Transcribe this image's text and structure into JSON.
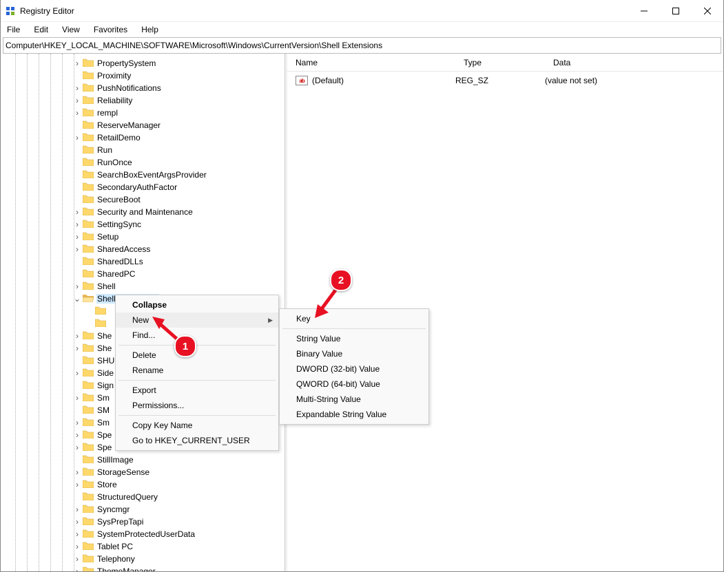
{
  "title": "Registry Editor",
  "menu": {
    "file": "File",
    "edit": "Edit",
    "view": "View",
    "fav": "Favorites",
    "help": "Help"
  },
  "address": "Computer\\HKEY_LOCAL_MACHINE\\SOFTWARE\\Microsoft\\Windows\\CurrentVersion\\Shell Extensions",
  "tree_indent_base": 104,
  "tree": [
    {
      "lvl": 0,
      "exp": ">",
      "label": "PropertySystem"
    },
    {
      "lvl": 0,
      "exp": "",
      "label": "Proximity"
    },
    {
      "lvl": 0,
      "exp": ">",
      "label": "PushNotifications"
    },
    {
      "lvl": 0,
      "exp": ">",
      "label": "Reliability"
    },
    {
      "lvl": 0,
      "exp": ">",
      "label": "rempl"
    },
    {
      "lvl": 0,
      "exp": "",
      "label": "ReserveManager"
    },
    {
      "lvl": 0,
      "exp": ">",
      "label": "RetailDemo"
    },
    {
      "lvl": 0,
      "exp": "",
      "label": "Run"
    },
    {
      "lvl": 0,
      "exp": "",
      "label": "RunOnce"
    },
    {
      "lvl": 0,
      "exp": "",
      "label": "SearchBoxEventArgsProvider"
    },
    {
      "lvl": 0,
      "exp": "",
      "label": "SecondaryAuthFactor"
    },
    {
      "lvl": 0,
      "exp": "",
      "label": "SecureBoot"
    },
    {
      "lvl": 0,
      "exp": ">",
      "label": "Security and Maintenance"
    },
    {
      "lvl": 0,
      "exp": ">",
      "label": "SettingSync"
    },
    {
      "lvl": 0,
      "exp": ">",
      "label": "Setup"
    },
    {
      "lvl": 0,
      "exp": ">",
      "label": "SharedAccess"
    },
    {
      "lvl": 0,
      "exp": "",
      "label": "SharedDLLs"
    },
    {
      "lvl": 0,
      "exp": "",
      "label": "SharedPC"
    },
    {
      "lvl": 0,
      "exp": ">",
      "label": "Shell"
    },
    {
      "lvl": 0,
      "exp": "v",
      "label": "Shell Extensions",
      "sel": true,
      "open": true
    },
    {
      "lvl": 1,
      "exp": "",
      "label": "",
      "partial": true,
      "cut": true
    },
    {
      "lvl": 1,
      "exp": "",
      "label": "",
      "partial": true,
      "cut": true
    },
    {
      "lvl": 0,
      "exp": ">",
      "label": "She",
      "cut": true
    },
    {
      "lvl": 0,
      "exp": ">",
      "label": "She",
      "cut": true
    },
    {
      "lvl": 0,
      "exp": "",
      "label": "SHU",
      "cut": true
    },
    {
      "lvl": 0,
      "exp": ">",
      "label": "Side",
      "cut": true
    },
    {
      "lvl": 0,
      "exp": "",
      "label": "Sign",
      "cut": true
    },
    {
      "lvl": 0,
      "exp": ">",
      "label": "Sm",
      "cut": true
    },
    {
      "lvl": 0,
      "exp": "",
      "label": "SM",
      "cut": true
    },
    {
      "lvl": 0,
      "exp": ">",
      "label": "Sm",
      "cut": true
    },
    {
      "lvl": 0,
      "exp": ">",
      "label": "Spe",
      "cut": true
    },
    {
      "lvl": 0,
      "exp": ">",
      "label": "Spe",
      "cut": true
    },
    {
      "lvl": 0,
      "exp": "",
      "label": "StillImage"
    },
    {
      "lvl": 0,
      "exp": ">",
      "label": "StorageSense"
    },
    {
      "lvl": 0,
      "exp": ">",
      "label": "Store"
    },
    {
      "lvl": 0,
      "exp": "",
      "label": "StructuredQuery"
    },
    {
      "lvl": 0,
      "exp": ">",
      "label": "Syncmgr"
    },
    {
      "lvl": 0,
      "exp": ">",
      "label": "SysPrepTapi"
    },
    {
      "lvl": 0,
      "exp": ">",
      "label": "SystemProtectedUserData"
    },
    {
      "lvl": 0,
      "exp": ">",
      "label": "Tablet PC"
    },
    {
      "lvl": 0,
      "exp": ">",
      "label": "Telephony"
    },
    {
      "lvl": 0,
      "exp": ">",
      "label": "ThemeManager"
    }
  ],
  "list": {
    "columns": {
      "name": "Name",
      "type": "Type",
      "data": "Data"
    },
    "rows": [
      {
        "name": "(Default)",
        "type": "REG_SZ",
        "data": "(value not set)"
      }
    ]
  },
  "ctx1": {
    "collapse": "Collapse",
    "new": "New",
    "find": "Find...",
    "delete": "Delete",
    "rename": "Rename",
    "export": "Export",
    "permissions": "Permissions...",
    "copykey": "Copy Key Name",
    "goto": "Go to HKEY_CURRENT_USER"
  },
  "ctx2": {
    "key": "Key",
    "string": "String Value",
    "binary": "Binary Value",
    "dword": "DWORD (32-bit) Value",
    "qword": "QWORD (64-bit) Value",
    "multi": "Multi-String Value",
    "expand": "Expandable String Value"
  },
  "callout": {
    "one": "1",
    "two": "2"
  }
}
